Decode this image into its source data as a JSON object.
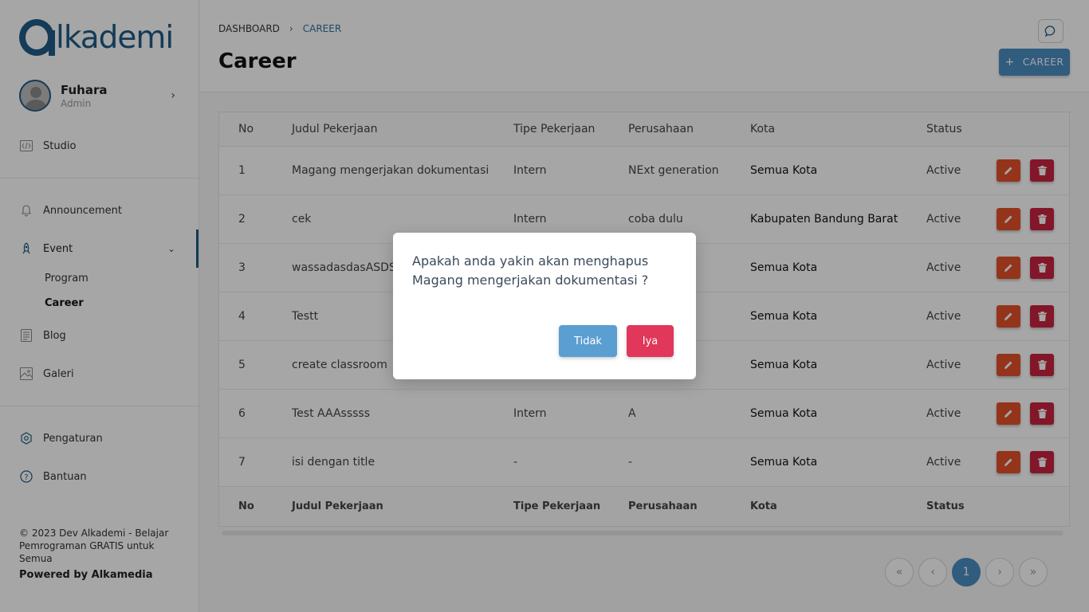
{
  "brand": {
    "logo_text": "lkademi"
  },
  "user": {
    "name": "Fuhara",
    "role": "Admin"
  },
  "nav": {
    "studio": "Studio",
    "announcement": "Announcement",
    "event": "Event",
    "program": "Program",
    "career": "Career",
    "blog": "Blog",
    "galeri": "Galeri",
    "pengaturan": "Pengaturan",
    "bantuan": "Bantuan"
  },
  "footer": {
    "copyright": "© 2023 Dev Alkademi - Belajar Pemrograman GRATIS untuk Semua",
    "powered": "Powered by Alkamedia"
  },
  "breadcrumb": {
    "root": "DASHBOARD",
    "current": "CAREER"
  },
  "page": {
    "title": "Career",
    "add_button": "CAREER"
  },
  "table": {
    "headers": [
      "No",
      "Judul Pekerjaan",
      "Tipe Pekerjaan",
      "Perusahaan",
      "Kota",
      "Status"
    ],
    "rows": [
      [
        "1",
        "Magang mengerjakan dokumentasi",
        "Intern",
        "NExt generation",
        "Semua Kota",
        "Active"
      ],
      [
        "2",
        "cek",
        "Intern",
        "coba dulu",
        "Kabupaten Bandung Barat",
        "Active"
      ],
      [
        "3",
        "wassadasdasASDSD",
        "",
        "",
        "Semua Kota",
        "Active"
      ],
      [
        "4",
        "Testt",
        "",
        "",
        "Semua Kota",
        "Active"
      ],
      [
        "5",
        "create classroom",
        "",
        "",
        "Semua Kota",
        "Active"
      ],
      [
        "6",
        "Test AAAsssss",
        "Intern",
        "A",
        "Semua Kota",
        "Active"
      ],
      [
        "7",
        "isi dengan title",
        "-",
        "-",
        "Semua Kota",
        "Active"
      ]
    ]
  },
  "pagination": {
    "first": "«",
    "prev": "‹",
    "current": "1",
    "next": "›",
    "last": "»"
  },
  "modal": {
    "message": "Apakah anda yakin akan menghapus Magang mengerjakan dokumentasi ?",
    "cancel": "Tidak",
    "confirm": "Iya"
  },
  "colors": {
    "primary": "#1f5b86",
    "accent": "#4a8ec2",
    "edit": "#e3502a",
    "delete": "#c8243f",
    "confirm": "#e0375a"
  }
}
